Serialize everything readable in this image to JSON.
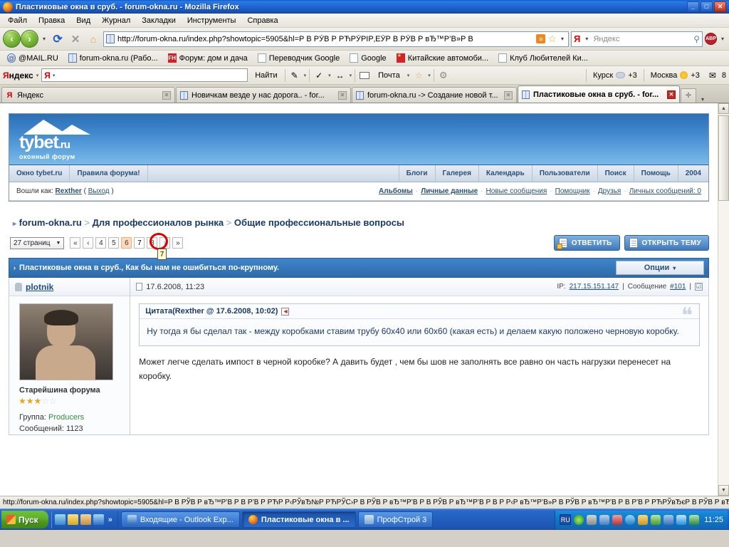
{
  "window": {
    "title": "Пластиковые окна в сруб. - forum-okna.ru - Mozilla Firefox",
    "minimize": "_",
    "maximize": "□",
    "close": "✕"
  },
  "menubar": {
    "items": [
      "Файл",
      "Правка",
      "Вид",
      "Журнал",
      "Закладки",
      "Инструменты",
      "Справка"
    ]
  },
  "navbar": {
    "back": "‹",
    "forward": "›",
    "dropdown": "▾",
    "reload": "⟳",
    "stop": "✕",
    "home": "⌂",
    "url": "http://forum-okna.ru/index.php?showtopic=5905&hl=Р В РЎВ Р РЋРЎРІР‚ЕЎР В РЎВ Р вЂ™Р’В»Р В",
    "rss": "≡",
    "star": "☆",
    "search_placeholder": "Яндекс",
    "search_value": "",
    "search_logo": "Я",
    "magnifier": "🔍",
    "abp": "ABP"
  },
  "bookmarks": [
    {
      "label": "@MAIL.RU",
      "icon": "mail-icon"
    },
    {
      "label": "forum-okna.ru (Рабо...",
      "icon": "window-icon"
    },
    {
      "label": "Форум: дом и дача",
      "icon": "fh-icon"
    },
    {
      "label": "Переводчик Google",
      "icon": "page-icon"
    },
    {
      "label": "Google",
      "icon": "page-icon"
    },
    {
      "label": "Китайские автомоби...",
      "icon": "china-flag-icon"
    },
    {
      "label": "Клуб Любителей Ки...",
      "icon": "page-icon"
    }
  ],
  "yandex_bar": {
    "logo_ya": "Я",
    "logo_rest": "ндекс",
    "input_value": "",
    "input_logo": "Я",
    "find_button": "Найти",
    "mail_label": "Почта",
    "city1": {
      "name": "Курск",
      "temp": "+3"
    },
    "city2": {
      "name": "Москва",
      "temp": "+3"
    },
    "mail_count": "8",
    "caret": "▾"
  },
  "tabs": [
    {
      "label": "Яндекс",
      "icon": "yandex-icon",
      "active": false,
      "close": "✕"
    },
    {
      "label": "Новичкам везде у нас дорога.. - for...",
      "icon": "window-icon",
      "active": false,
      "close": "✕"
    },
    {
      "label": "forum-okna.ru -> Создание новой т...",
      "icon": "window-icon",
      "active": false,
      "close": "✕"
    },
    {
      "label": "Пластиковые окна в сруб. - for...",
      "icon": "window-icon",
      "active": true,
      "close": "✕"
    }
  ],
  "tab_controls": {
    "new_tab": "✛",
    "list": "▾"
  },
  "forum": {
    "logo": {
      "word": "tybet",
      "domain": ".ru",
      "subtitle": "оконный форум"
    },
    "nav_left": [
      "Окно tybet.ru",
      "Правила форума!"
    ],
    "nav_right": [
      "Блоги",
      "Галерея",
      "Календарь",
      "Пользователи",
      "Поиск",
      "Помощь",
      "2004"
    ],
    "userbar": {
      "logged_label": "Вошли как:",
      "username": "Rexther",
      "logout_open": "(",
      "logout": "Выход",
      "logout_close": ")",
      "links": [
        "Альбомы",
        "Личные данные",
        "Новые сообщения",
        "Помощник",
        "Друзья",
        "Личных сообщений: 0"
      ]
    },
    "breadcrumb": {
      "arrow": "▸",
      "root": "forum-okna.ru",
      "sep": ">",
      "level1": "Для профессионалов рынка",
      "level2": "Общие профессиональные вопросы"
    },
    "pagination": {
      "select_label": "27 страниц",
      "select_caret": "▼",
      "pages": [
        "«",
        "‹",
        "4",
        "5",
        "6",
        "7",
        "8",
        "›",
        "»"
      ],
      "current": "7",
      "previous_visited": "6",
      "tooltip": "7"
    },
    "actions": {
      "reply": "ОТВЕТИТЬ",
      "new_topic": "ОТКРЫТЬ ТЕМУ"
    },
    "topic": {
      "arrow": "›",
      "title": "Пластиковые окна в сруб., Как бы нам не ошибиться по-крупному.",
      "options": "Опции",
      "options_caret": "▾"
    },
    "post": {
      "author": "plotnik",
      "date": "17.6.2008, 11:23",
      "ip_label": "IP:",
      "ip": "217.15.151.147",
      "sep": "|",
      "msg_label": "Сообщение",
      "msg_number": "#101",
      "checkbox": "☑",
      "rank": "Старейшина форума",
      "stars_on": "★★★",
      "stars_off": "☆☆",
      "group_label": "Группа:",
      "group": "Producers",
      "posts_label": "Сообщений:",
      "posts": "1123",
      "quote": {
        "header": "Цитата(Rexther @ 17.6.2008, 10:02)",
        "collapse": "◄",
        "mark": "❝",
        "body": "Ну тогда я бы сделал так - между коробками ставим трубу 60x40 или 60x60 (какая есть) и делаем какую положено черновую коробку."
      },
      "body": "Может легче сделать импост в черной коробке? А давить будет , чем бы шов не заполнять все равно он часть нагрузки перенесет на коробку."
    }
  },
  "scrollbar": {
    "up": "▲",
    "down": "▼"
  },
  "statusbar": {
    "text": "http://forum-okna.ru/index.php?showtopic=5905&hl=Р В РЎВ Р вЂ™Р’В Р В Р’В Р РЋР Р‹РЎвЂ№Р РЋРЎС›Р В РЎВ Р вЂ™Р’В Р В РЎВ Р вЂ™Р’В Р В Р Р‹Р вЂ™Р’В»Р В РЎВ Р вЂ™Р’В Р В Р’В Р РЋРЎвЂєР В РЎВ Р вЂ™Р’В Р В Р’В Р вЂ™Р’№Р В Р’В Р Р‚..."
  },
  "taskbar": {
    "start": "Пуск",
    "quick_launch_chevron": "»",
    "tasks": [
      {
        "label": "Входящие - Outlook Exp...",
        "active": false,
        "icon": "outlook-icon"
      },
      {
        "label": "Пластиковые окна в ...",
        "active": true,
        "icon": "firefox-icon"
      },
      {
        "label": "ПрофСтрой 3",
        "active": false,
        "icon": "profstroy-icon"
      }
    ],
    "language": "RU",
    "clock": "11:25"
  }
}
